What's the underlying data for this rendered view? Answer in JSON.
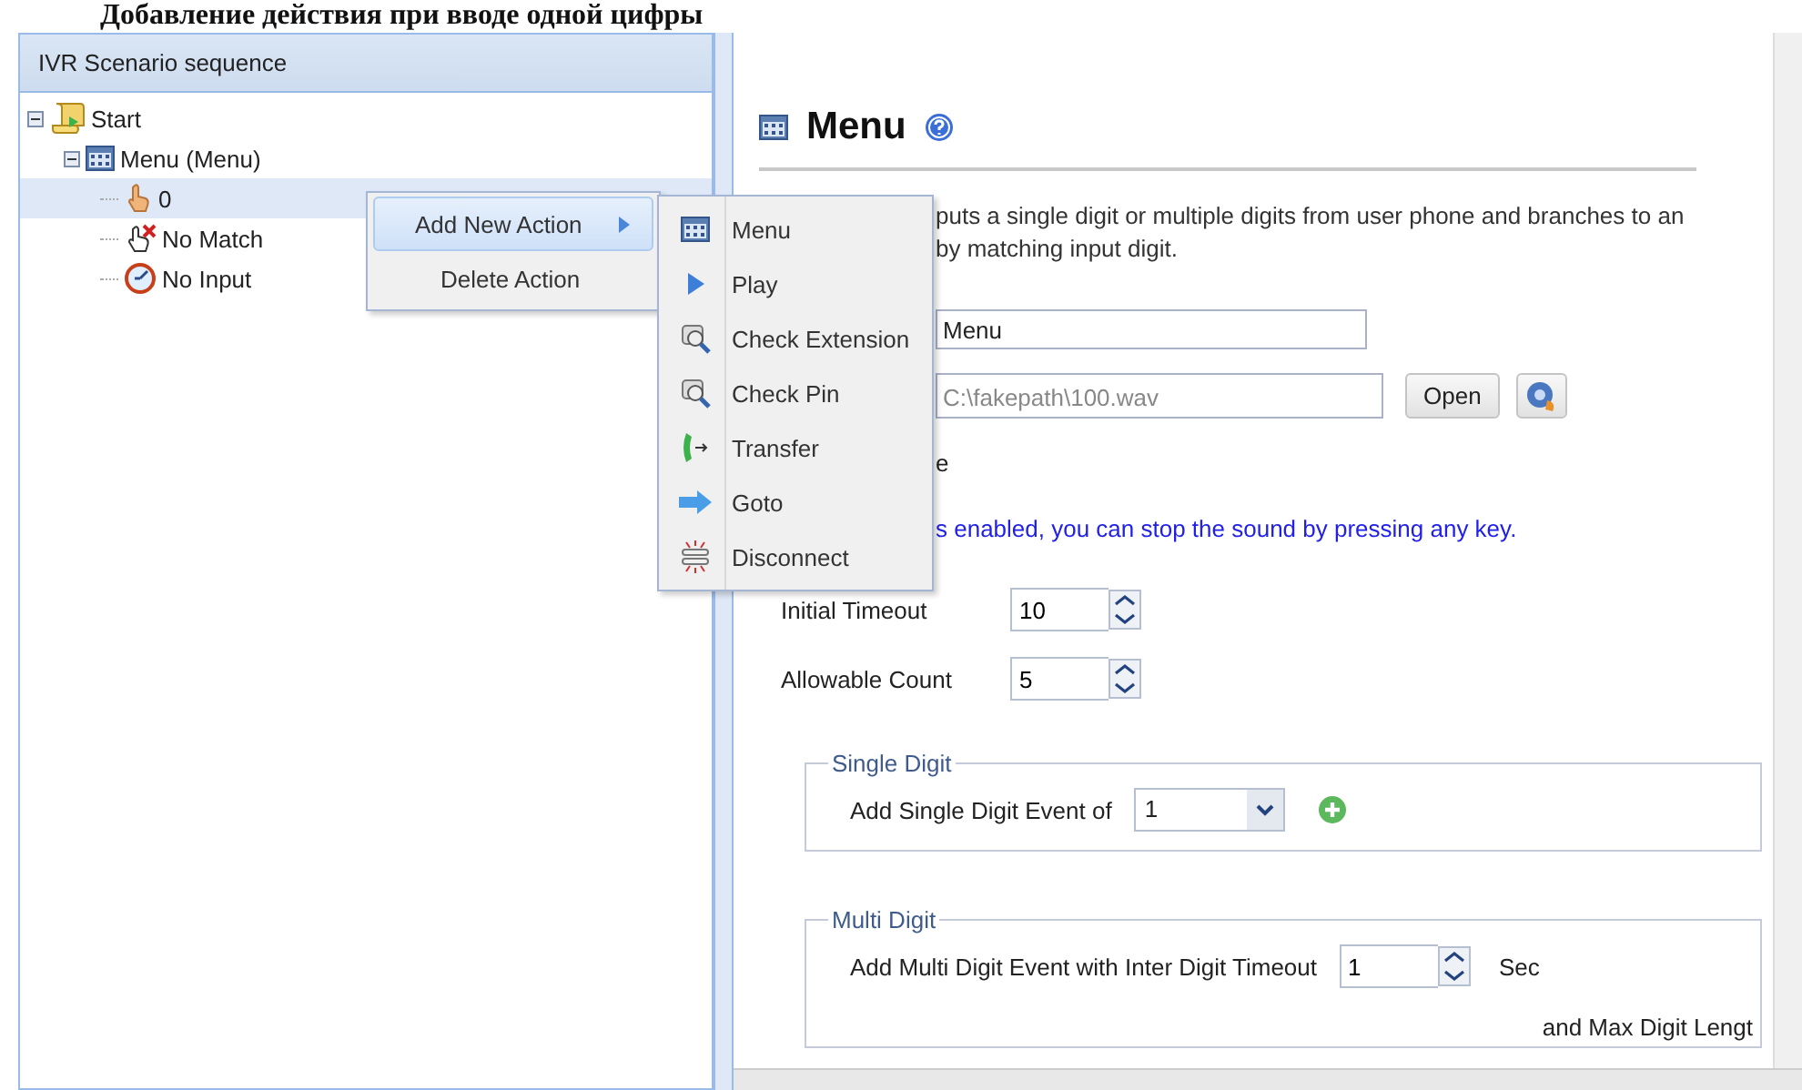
{
  "doc_heading": "Добавление действия при вводе одной цифры",
  "tree_panel": {
    "title": "IVR Scenario sequence",
    "nodes": [
      {
        "label": "Start",
        "kind": "scroll",
        "expanded": true,
        "selected": false,
        "children": [
          {
            "label": "Menu (Menu)",
            "kind": "menu",
            "expanded": true,
            "selected": false,
            "children": [
              {
                "label": "0",
                "kind": "hand",
                "selected": true
              },
              {
                "label": "No Match",
                "kind": "hand-x",
                "selected": false
              },
              {
                "label": "No Input",
                "kind": "clock",
                "selected": false
              }
            ]
          }
        ]
      }
    ]
  },
  "context_menu": {
    "items": [
      {
        "label": "Add New Action",
        "selected": true,
        "has_submenu": true
      },
      {
        "label": "Delete Action",
        "selected": false,
        "has_submenu": false
      }
    ]
  },
  "submenu": {
    "items": [
      {
        "label": "Menu",
        "kind": "menu"
      },
      {
        "label": "Play",
        "kind": "play"
      },
      {
        "label": "Check Extension",
        "kind": "check"
      },
      {
        "label": "Check Pin",
        "kind": "check"
      },
      {
        "label": "Transfer",
        "kind": "transfer"
      },
      {
        "label": "Goto",
        "kind": "goto"
      },
      {
        "label": "Disconnect",
        "kind": "disconnect"
      }
    ]
  },
  "editor": {
    "title": "Menu",
    "description_lines": [
      "puts a single digit or multiple digits from user phone and branches to an",
      "by matching input digit."
    ],
    "name_value": "Menu",
    "file_value": "C:\\fakepath\\100.wav",
    "open_button": "Open",
    "option_label_tail": "e",
    "note": "s enabled, you can stop the sound by pressing any key.",
    "spinners": [
      {
        "label": "Initial Timeout",
        "value": "10"
      },
      {
        "label": "Allowable Count",
        "value": "5"
      }
    ],
    "single_digit": {
      "legend": "Single Digit",
      "label": "Add Single Digit Event of",
      "value": "1"
    },
    "multi_digit": {
      "legend": "Multi Digit",
      "label": "Add Multi Digit Event with Inter Digit Timeout",
      "value": "1",
      "unit": "Sec",
      "next_line": "and Max Digit Lengt"
    }
  }
}
